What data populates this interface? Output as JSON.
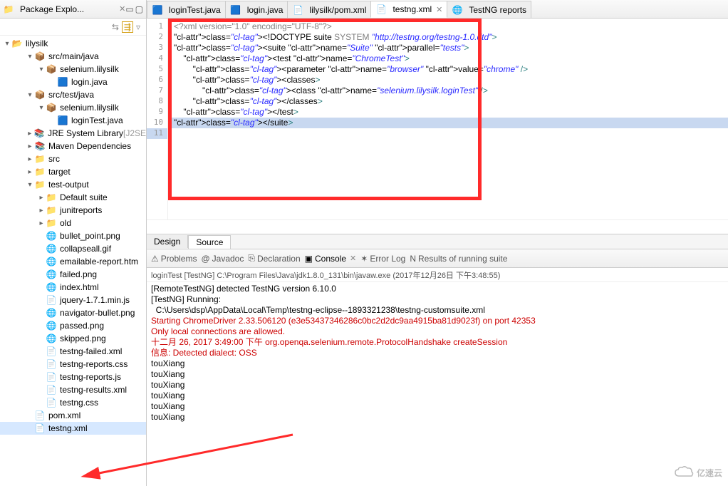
{
  "sidebar": {
    "title": "Package Explo...",
    "project": "lilysilk",
    "nodes": [
      {
        "label": "src/main/java",
        "indent": 1,
        "exp": "▾",
        "icon": "pkg"
      },
      {
        "label": "selenium.lilysilk",
        "indent": 2,
        "exp": "▾",
        "icon": "pkg"
      },
      {
        "label": "login.java",
        "indent": 3,
        "exp": "",
        "icon": "java"
      },
      {
        "label": "src/test/java",
        "indent": 1,
        "exp": "▾",
        "icon": "pkg"
      },
      {
        "label": "selenium.lilysilk",
        "indent": 2,
        "exp": "▾",
        "icon": "pkg"
      },
      {
        "label": "loginTest.java",
        "indent": 3,
        "exp": "",
        "icon": "java"
      },
      {
        "label": "JRE System Library",
        "suffix": "[J2SE",
        "indent": 1,
        "exp": "▸",
        "icon": "lib"
      },
      {
        "label": "Maven Dependencies",
        "indent": 1,
        "exp": "▸",
        "icon": "lib"
      },
      {
        "label": "src",
        "indent": 1,
        "exp": "▸",
        "icon": "folder"
      },
      {
        "label": "target",
        "indent": 1,
        "exp": "▸",
        "icon": "folder"
      },
      {
        "label": "test-output",
        "indent": 1,
        "exp": "▾",
        "icon": "folder"
      },
      {
        "label": "Default suite",
        "indent": 2,
        "exp": "▸",
        "icon": "folder"
      },
      {
        "label": "junitreports",
        "indent": 2,
        "exp": "▸",
        "icon": "folder"
      },
      {
        "label": "old",
        "indent": 2,
        "exp": "▸",
        "icon": "folder"
      },
      {
        "label": "bullet_point.png",
        "indent": 2,
        "exp": "",
        "icon": "png"
      },
      {
        "label": "collapseall.gif",
        "indent": 2,
        "exp": "",
        "icon": "png"
      },
      {
        "label": "emailable-report.htm",
        "indent": 2,
        "exp": "",
        "icon": "png"
      },
      {
        "label": "failed.png",
        "indent": 2,
        "exp": "",
        "icon": "png"
      },
      {
        "label": "index.html",
        "indent": 2,
        "exp": "",
        "icon": "png"
      },
      {
        "label": "jquery-1.7.1.min.js",
        "indent": 2,
        "exp": "",
        "icon": "js"
      },
      {
        "label": "navigator-bullet.png",
        "indent": 2,
        "exp": "",
        "icon": "png"
      },
      {
        "label": "passed.png",
        "indent": 2,
        "exp": "",
        "icon": "png"
      },
      {
        "label": "skipped.png",
        "indent": 2,
        "exp": "",
        "icon": "png"
      },
      {
        "label": "testng-failed.xml",
        "indent": 2,
        "exp": "",
        "icon": "xml"
      },
      {
        "label": "testng-reports.css",
        "indent": 2,
        "exp": "",
        "icon": "css"
      },
      {
        "label": "testng-reports.js",
        "indent": 2,
        "exp": "",
        "icon": "js"
      },
      {
        "label": "testng-results.xml",
        "indent": 2,
        "exp": "",
        "icon": "xml"
      },
      {
        "label": "testng.css",
        "indent": 2,
        "exp": "",
        "icon": "css"
      },
      {
        "label": "pom.xml",
        "indent": 1,
        "exp": "",
        "icon": "xml"
      },
      {
        "label": "testng.xml",
        "indent": 1,
        "exp": "",
        "icon": "xml",
        "selected": true
      }
    ]
  },
  "tabs": [
    {
      "label": "loginTest.java",
      "icon": "java"
    },
    {
      "label": "login.java",
      "icon": "java"
    },
    {
      "label": "lilysilk/pom.xml",
      "icon": "xml"
    },
    {
      "label": "testng.xml",
      "icon": "xml",
      "active": true,
      "close": true
    },
    {
      "label": "TestNG reports",
      "icon": "web"
    }
  ],
  "code_lines": [
    "1",
    "2",
    "3",
    "4",
    "5",
    "6",
    "7",
    "8",
    "9",
    "10",
    "11"
  ],
  "code_html": [
    {
      "n": "1",
      "t": "<?xml version=\"1.0\" encoding=\"UTF-8\"?>",
      "cls": "cl-pi"
    },
    {
      "n": "2",
      "raw": "<!DOCTYPE suite SYSTEM \"http://testng.org/testng-1.0.dtd\">"
    },
    {
      "n": "3",
      "raw": "<suite name=\"Suite\" parallel=\"tests\">"
    },
    {
      "n": "4",
      "raw": ""
    },
    {
      "n": "5",
      "raw": "    <test name=\"ChromeTest\">"
    },
    {
      "n": "6",
      "raw": "        <parameter name=\"browser\" value=\"chrome\" />"
    },
    {
      "n": "7",
      "raw": "        <classes>"
    },
    {
      "n": "8",
      "raw": "            <class name=\"selenium.lilysilk.loginTest\" />"
    },
    {
      "n": "9",
      "raw": "        </classes>"
    },
    {
      "n": "10",
      "raw": "    </test>"
    },
    {
      "n": "11",
      "raw": "</suite>",
      "cursor": true
    }
  ],
  "bottom_tabs": {
    "design": "Design",
    "source": "Source"
  },
  "views": [
    {
      "label": "Problems",
      "icon": "⚠"
    },
    {
      "label": "Javadoc",
      "icon": "@"
    },
    {
      "label": "Declaration",
      "icon": "⎘"
    },
    {
      "label": "Console",
      "icon": "▣",
      "active": true,
      "close": true
    },
    {
      "label": "Error Log",
      "icon": "✶"
    },
    {
      "label": "Results of running suite",
      "icon": "N"
    }
  ],
  "console": {
    "header": "loginTest [TestNG] C:\\Program Files\\Java\\jdk1.8.0_131\\bin\\javaw.exe (2017年12月26日 下午3:48:55)",
    "lines": [
      {
        "t": "[RemoteTestNG] detected TestNG version 6.10.0"
      },
      {
        "t": "[TestNG] Running:"
      },
      {
        "t": "  C:\\Users\\dsp\\AppData\\Local\\Temp\\testng-eclipse--1893321238\\testng-customsuite.xml"
      },
      {
        "t": ""
      },
      {
        "t": "Starting ChromeDriver 2.33.506120 (e3e53437346286c0bc2d2dc9aa4915ba81d9023f) on port 42353",
        "red": true
      },
      {
        "t": "Only local connections are allowed.",
        "red": true
      },
      {
        "t": "十二月 26, 2017 3:49:00 下午 org.openqa.selenium.remote.ProtocolHandshake createSession",
        "red": true
      },
      {
        "t": "信息: Detected dialect: OSS",
        "red": true
      },
      {
        "t": "touXiang"
      },
      {
        "t": "touXiang"
      },
      {
        "t": "touXiang"
      },
      {
        "t": "touXiang"
      },
      {
        "t": "touXiang"
      },
      {
        "t": "touXiang"
      }
    ]
  },
  "watermark": "亿速云"
}
